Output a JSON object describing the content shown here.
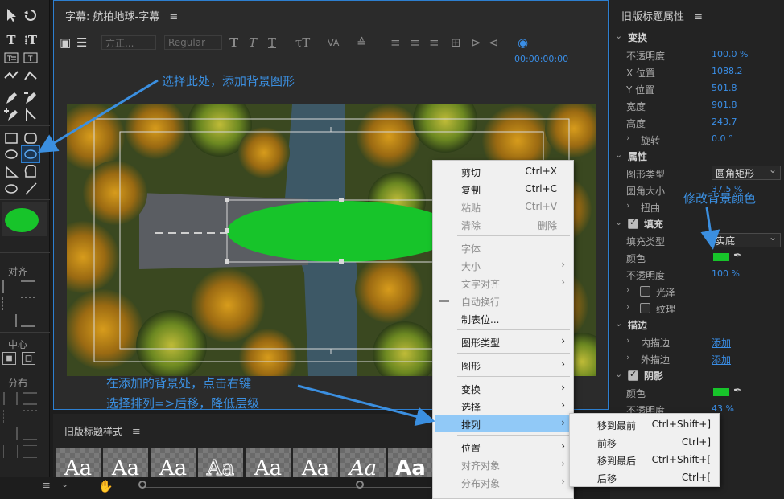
{
  "tools": {
    "sections": {
      "align": "对齐",
      "center": "中心",
      "distribute": "分布"
    },
    "preview_color": "#17c42a"
  },
  "editor": {
    "title": "字幕: 航拍地球-字幕",
    "menu_glyph": "≡",
    "font_family": "方正...",
    "font_style": "Regular",
    "timecode": "00:00:00:00",
    "shape_color": "#17c42a"
  },
  "styles_panel": {
    "title": "旧版标题样式",
    "menu_glyph": "≡",
    "swatches": [
      "Aa",
      "Aa",
      "Aa",
      "Aa",
      "Aa",
      "Aa",
      "Aa",
      "Aa"
    ]
  },
  "properties": {
    "title": "旧版标题属性",
    "menu_glyph": "≡",
    "transform": {
      "header": "变换",
      "opacity_label": "不透明度",
      "opacity": "100.0 %",
      "x_label": "X 位置",
      "x": "1088.2",
      "y_label": "Y 位置",
      "y": "501.8",
      "width_label": "宽度",
      "width": "901.8",
      "height_label": "高度",
      "height": "243.7",
      "rotation_label": "旋转",
      "rotation": "0.0 °"
    },
    "attributes": {
      "header": "属性",
      "shape_type_label": "图形类型",
      "shape_type": "圆角矩形",
      "corner_size_label": "圆角大小",
      "corner_size": "37.5 %",
      "distort_label": "扭曲"
    },
    "fill": {
      "header": "填充",
      "fill_type_label": "填充类型",
      "fill_type": "实底",
      "color_label": "颜色",
      "color": "#17c42a",
      "opacity_label": "不透明度",
      "opacity": "100 %",
      "sheen_label": "光泽",
      "texture_label": "纹理"
    },
    "strokes": {
      "header": "描边",
      "inner_label": "内描边",
      "inner_action": "添加",
      "outer_label": "外描边",
      "outer_action": "添加"
    },
    "shadow": {
      "header": "阴影",
      "color_label": "颜色",
      "color": "#17c42a",
      "opacity_label": "不透明度",
      "opacity": "43 %"
    }
  },
  "context_menu": {
    "items": [
      {
        "label": "剪切",
        "shortcut": "Ctrl+X"
      },
      {
        "label": "复制",
        "shortcut": "Ctrl+C"
      },
      {
        "label": "粘贴",
        "shortcut": "Ctrl+V"
      },
      {
        "label": "清除",
        "shortcut": "删除"
      },
      {
        "label": "字体",
        "shortcut": ""
      },
      {
        "label": "大小",
        "shortcut": ""
      },
      {
        "label": "文字对齐",
        "shortcut": ""
      },
      {
        "label": "自动换行",
        "shortcut": ""
      },
      {
        "label": "制表位...",
        "shortcut": ""
      },
      {
        "label": "图形类型",
        "shortcut": ""
      },
      {
        "label": "图形",
        "shortcut": ""
      },
      {
        "label": "变换",
        "shortcut": ""
      },
      {
        "label": "选择",
        "shortcut": ""
      },
      {
        "label": "排列",
        "shortcut": ""
      },
      {
        "label": "位置",
        "shortcut": ""
      },
      {
        "label": "对齐对象",
        "shortcut": ""
      },
      {
        "label": "分布对象",
        "shortcut": ""
      }
    ],
    "submenu": [
      {
        "label": "移到最前",
        "shortcut": "Ctrl+Shift+]"
      },
      {
        "label": "前移",
        "shortcut": "Ctrl+]"
      },
      {
        "label": "移到最后",
        "shortcut": "Ctrl+Shift+["
      },
      {
        "label": "后移",
        "shortcut": "Ctrl+["
      }
    ]
  },
  "annotations": {
    "top": "选择此处，添加背景图形",
    "right": "修改背景颜色",
    "bottom_line1": "在添加的背景处，点击右键",
    "bottom_line2": "选择排列=>后移，降低层级",
    "color": "#3b8fe0"
  }
}
